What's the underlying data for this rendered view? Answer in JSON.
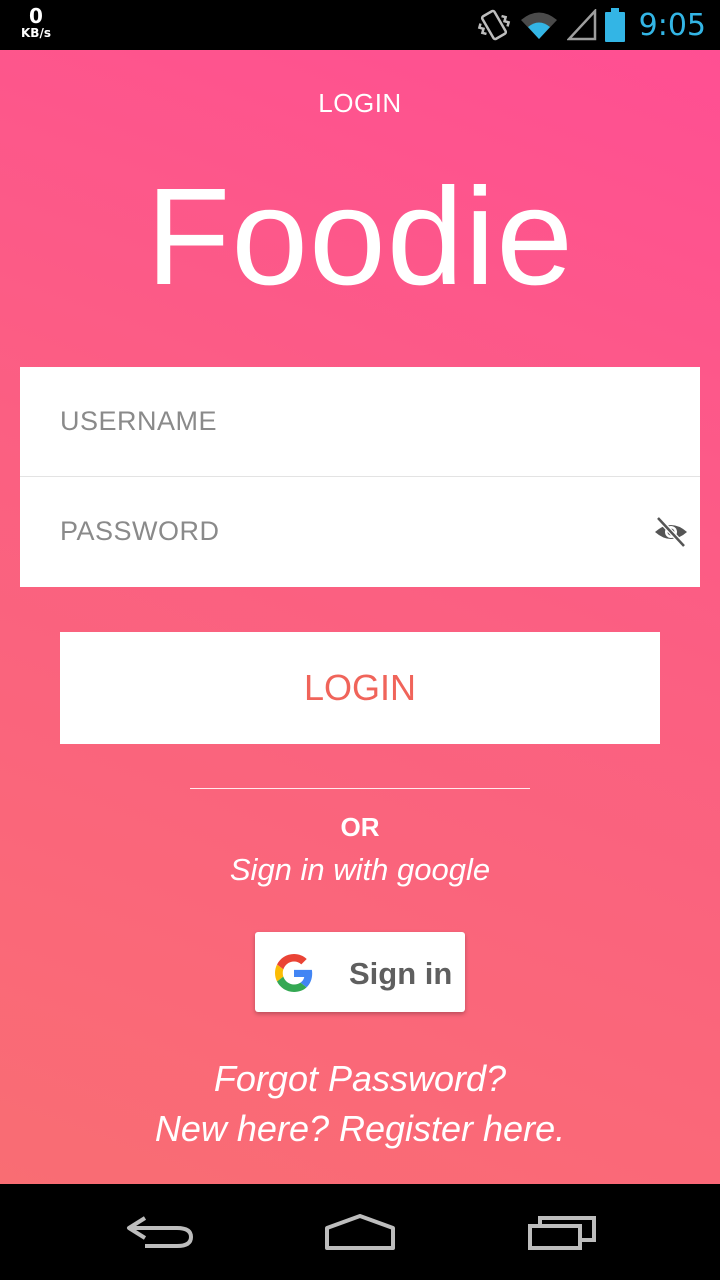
{
  "status_bar": {
    "speed_value": "0",
    "speed_unit": "KB/s",
    "time": "9:05",
    "icons": [
      "vibrate-icon",
      "wifi-icon",
      "signal-icon",
      "battery-icon"
    ],
    "clock_color": "#33b5e5"
  },
  "header": {
    "title": "LOGIN"
  },
  "brand": {
    "name": "Foodie"
  },
  "form": {
    "username": {
      "value": "",
      "placeholder": "USERNAME"
    },
    "password": {
      "value": "",
      "placeholder": "PASSWORD",
      "toggle_icon": "visibility-off-icon"
    }
  },
  "login_button": {
    "label": "LOGIN",
    "color": "#f0645a"
  },
  "separator": {
    "or_label": "OR",
    "google_hint": "Sign in with google"
  },
  "google_button": {
    "label": "Sign in",
    "icon": "google-logo-icon"
  },
  "links": {
    "forgot": "Forgot Password?",
    "register": "New here? Register here."
  },
  "nav_bar": {
    "icons": [
      "back-icon",
      "home-icon",
      "recents-icon"
    ]
  },
  "colors": {
    "gradient_top": "#ff4f93",
    "gradient_bottom": "#f96d73"
  }
}
